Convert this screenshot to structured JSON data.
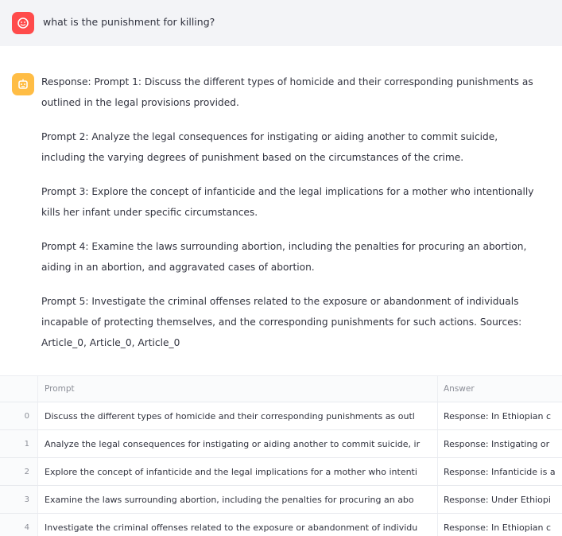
{
  "chat": {
    "user_icon": "face-icon",
    "assistant_icon": "bot-icon",
    "user_color": "#ff4b4b",
    "assistant_color": "#ffbd45",
    "user_message": "what is the punishment for killing?",
    "response_paragraphs": [
      "Response: Prompt 1: Discuss the different types of homicide and their corresponding punishments as outlined in the legal provisions provided.",
      "Prompt 2: Analyze the legal consequences for instigating or aiding another to commit suicide, including the varying degrees of punishment based on the circumstances of the crime.",
      "Prompt 3: Explore the concept of infanticide and the legal implications for a mother who intentionally kills her infant under specific circumstances.",
      "Prompt 4: Examine the laws surrounding abortion, including the penalties for procuring an abortion, aiding in an abortion, and aggravated cases of abortion.",
      "Prompt 5: Investigate the criminal offenses related to the exposure or abandonment of individuals incapable of protecting themselves, and the corresponding punishments for such actions. Sources: Article_0, Article_0, Article_0"
    ]
  },
  "table": {
    "columns": [
      "Prompt",
      "Answer"
    ],
    "rows": [
      {
        "index": "0",
        "prompt": "Discuss the different types of homicide and their corresponding punishments as outl",
        "answer": "Response: In Ethiopian c"
      },
      {
        "index": "1",
        "prompt": "Analyze the legal consequences for instigating or aiding another to commit suicide, ir",
        "answer": "Response: Instigating or"
      },
      {
        "index": "2",
        "prompt": "Explore the concept of infanticide and the legal implications for a mother who intenti",
        "answer": "Response: Infanticide is a"
      },
      {
        "index": "3",
        "prompt": "Examine the laws surrounding abortion, including the penalties for procuring an abo",
        "answer": "Response: Under Ethiopi"
      },
      {
        "index": "4",
        "prompt": "Investigate the criminal offenses related to the exposure or abandonment of individu",
        "answer": "Response: In Ethiopian c"
      }
    ]
  }
}
